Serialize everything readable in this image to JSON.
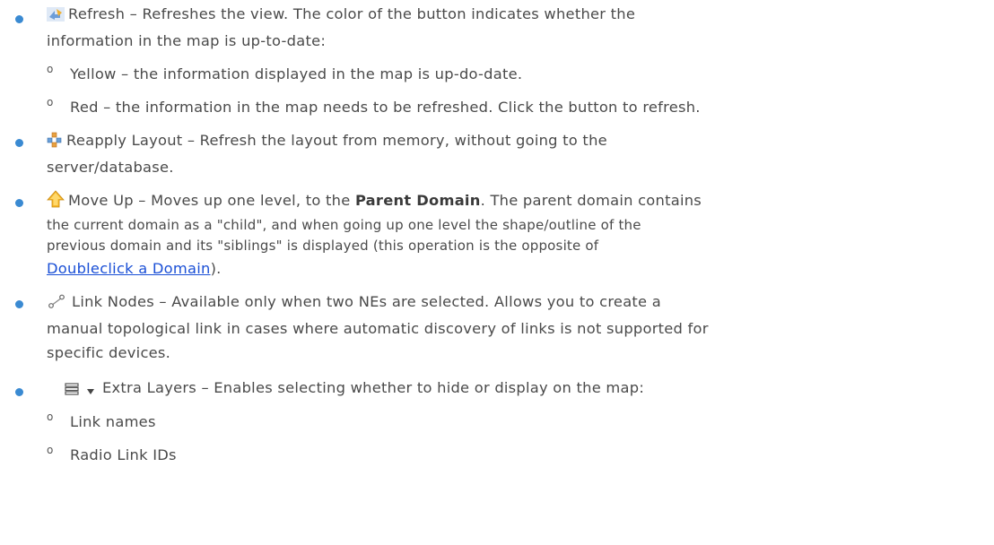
{
  "refresh": {
    "icon": "refresh-icon",
    "line1": "Refresh – Refreshes the view. The color of the button indicates whether the",
    "line2": "information in the map is up-to-date:",
    "sub": [
      "Yellow – the information displayed in the map is up-do-date.",
      "Red – the information in the map needs to be refreshed. Click the button to refresh."
    ]
  },
  "reapply": {
    "icon": "layout-icon",
    "line1": "Reapply Layout – Refresh the layout from memory, without going to the",
    "line2": "server/database."
  },
  "moveup": {
    "icon": "up-arrow-icon",
    "line1_a": "Move Up – Moves up one level, to the ",
    "line1_bold": "Parent Domain",
    "line1_b": ". The parent domain contains",
    "line2": "the current domain as a \"child\", and when going up one level the shape/outline of the",
    "line3": "previous domain and its \"siblings\" is displayed (this operation is the opposite of",
    "link": "Doubleclick a Domain",
    "line4_end": ")."
  },
  "linknodes": {
    "icon": "link-nodes-icon",
    "line1": "Link Nodes – Available only when two NEs are selected. Allows you to create a",
    "line2": "manual topological link in cases where automatic discovery of links is not supported for",
    "line3": "specific devices."
  },
  "extralayers": {
    "icon": "layers-icon",
    "dropdown_icon": "chevron-down-icon",
    "line1": "Extra Layers – Enables selecting whether to hide or display on the map:",
    "sub": [
      "Link names",
      "Radio Link IDs"
    ]
  },
  "ring_glyph": "o"
}
